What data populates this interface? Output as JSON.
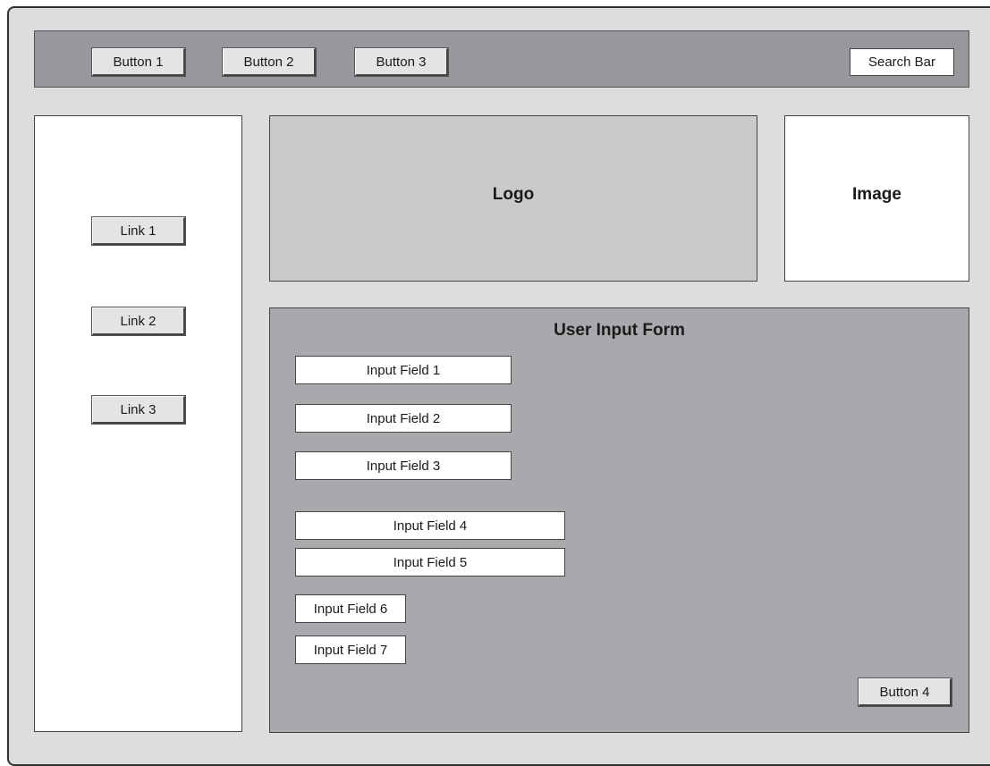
{
  "header": {
    "buttons": [
      "Button 1",
      "Button 2",
      "Button 3"
    ],
    "search_label": "Search Bar"
  },
  "sidebar": {
    "links": [
      "Link 1",
      "Link 2",
      "Link 3"
    ]
  },
  "logo": {
    "label": "Logo"
  },
  "image": {
    "label": "Image"
  },
  "form": {
    "title": "User Input Form",
    "fields": [
      "Input Field 1",
      "Input Field 2",
      "Input Field 3",
      "Input Field 4",
      "Input Field 5",
      "Input Field 6",
      "Input Field 7"
    ],
    "submit_label": "Button 4"
  }
}
